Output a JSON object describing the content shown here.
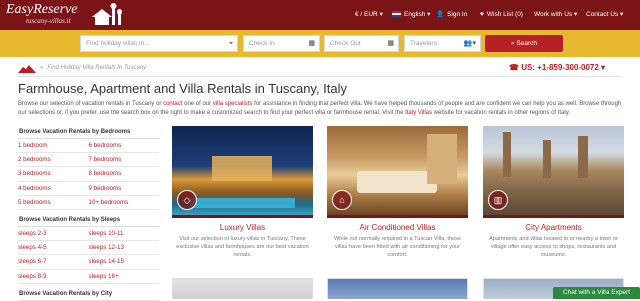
{
  "header": {
    "logo_title": "EasyReserve",
    "logo_sub": "tuscany-villas.it",
    "currency": "€ / EUR",
    "language": "English",
    "sign_in": "Sign In",
    "wishlist": "Wish List (0)",
    "work_with_us": "Work with Us",
    "contact_us": "Contact Us",
    "brand_color": "#7a1416"
  },
  "search": {
    "place_placeholder": "Find holiday villas in...",
    "checkin_placeholder": "Check In",
    "checkout_placeholder": "Check Out",
    "travelers_placeholder": "Travelers",
    "button_label": "Search",
    "bar_color": "#e8b830"
  },
  "breadcrumb": {
    "label": "Find Holiday Villa Rentals In Tuscany"
  },
  "phone": "US: +1-859-300-0072",
  "page": {
    "title": "Farmhouse, Apartment and Villa Rentals in Tuscany, Italy",
    "intro_1": "Browse our selection of vacation rentals in Tuscany or ",
    "intro_link_contact": "contact",
    "intro_2": " one of our ",
    "intro_link_specialists": "villa specialists",
    "intro_3": " for assistance in finding that perfect villa. We have helped thousands of people and are confident we can help you as well. Browse through our selections or, if you prefer, use the search box on the right to make a customized search to find your perfect villa or farmhouse rental. Visit the ",
    "intro_link_italy": "Italy Villas",
    "intro_4": " website for vacation rentals in other regions of Italy."
  },
  "sidebar": {
    "bedrooms_title": "Browse Vacation Rentals by Bedrooms",
    "bedrooms": [
      [
        "1 bedroom",
        "6 bedrooms"
      ],
      [
        "2 bedrooms",
        "7 bedrooms"
      ],
      [
        "3 bedrooms",
        "8 bedrooms"
      ],
      [
        "4 bedrooms",
        "9 bedrooms"
      ],
      [
        "5 bedrooms",
        "10+ bedrooms"
      ]
    ],
    "sleeps_title": "Browse Vacation Rentals by Sleeps",
    "sleeps": [
      [
        "sleeps 2-3",
        "sleeps 10-11"
      ],
      [
        "sleeps 4-5",
        "sleeps 12-13"
      ],
      [
        "sleeps 6-7",
        "sleeps 14-15"
      ],
      [
        "sleeps 8-9",
        "sleeps 16+"
      ]
    ],
    "city_title": "Browse Vacation Rentals by City"
  },
  "cards": [
    {
      "title": "Luxury Villas",
      "icon": "diamond-icon",
      "text": "Visit our selection of luxury villas in Tuscany. These exclusive villas and farmhouses are our best vacation rentals."
    },
    {
      "title": "Air Conditioned Villas",
      "icon": "house-icon",
      "text": "While not normally required in a Tuscan Villa, these villas have been fitted with air conditioning for your comfort."
    },
    {
      "title": "City Apartments",
      "icon": "building-icon",
      "text": "Apartments and villas located in or nearby a town or village offer easy access to shops, restaurants and museums."
    }
  ],
  "chat": "Chat with a Villa Expert"
}
